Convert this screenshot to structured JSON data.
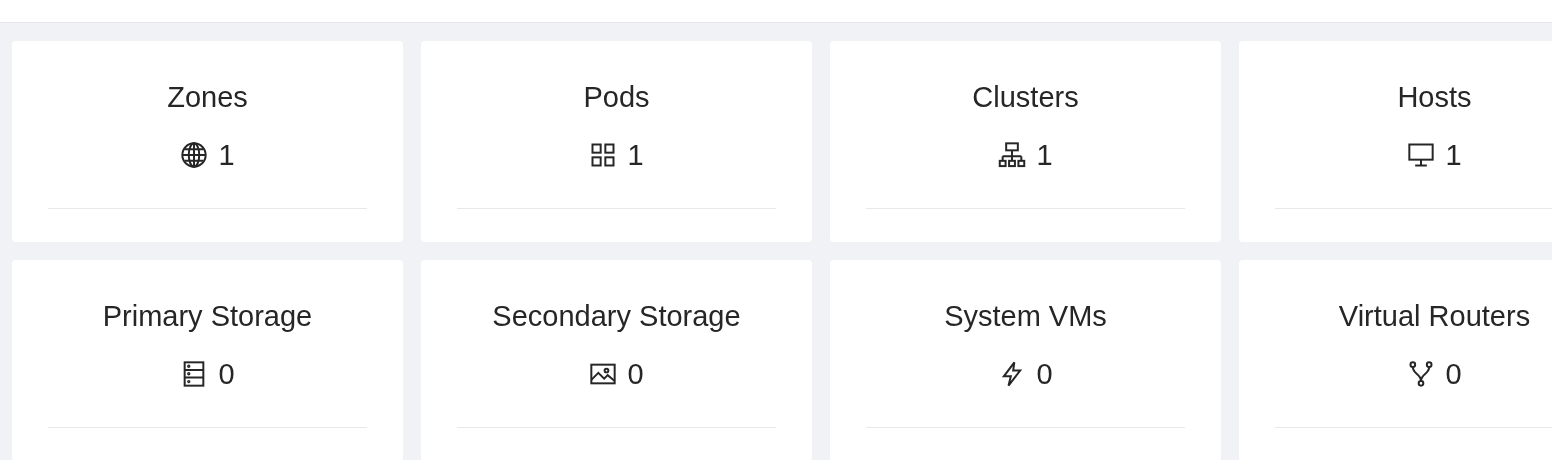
{
  "cards": [
    {
      "title": "Zones",
      "count": "1"
    },
    {
      "title": "Pods",
      "count": "1"
    },
    {
      "title": "Clusters",
      "count": "1"
    },
    {
      "title": "Hosts",
      "count": "1"
    },
    {
      "title": "Primary Storage",
      "count": "0"
    },
    {
      "title": "Secondary Storage",
      "count": "0"
    },
    {
      "title": "System VMs",
      "count": "0"
    },
    {
      "title": "Virtual Routers",
      "count": "0"
    }
  ]
}
